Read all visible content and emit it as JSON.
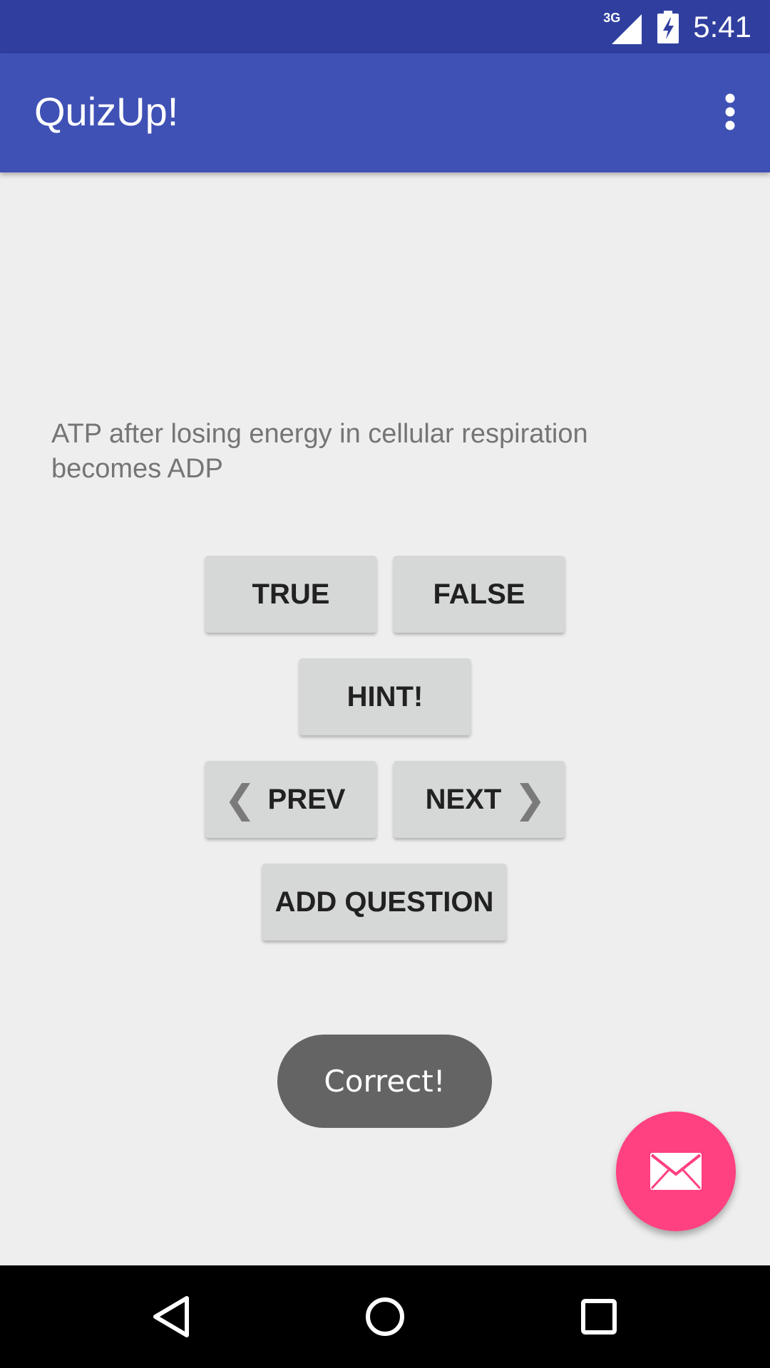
{
  "status_bar": {
    "network_type": "3G",
    "time": "5:41",
    "icons": [
      "signal-icon",
      "battery-charging-icon"
    ]
  },
  "app_bar": {
    "title": "QuizUp!",
    "menu_icon": "more-vert-icon"
  },
  "question": {
    "text": "ATP after losing energy in cellular respiration becomes ADP"
  },
  "buttons": {
    "true_label": "TRUE",
    "false_label": "FALSE",
    "hint_label": "HINT!",
    "prev_label": "PREV",
    "next_label": "NEXT",
    "add_question_label": "ADD QUESTION",
    "prev_icon": "chevron-left-icon",
    "next_icon": "chevron-right-icon"
  },
  "toast": {
    "message": "Correct!"
  },
  "fab": {
    "icon": "email-icon",
    "color": "#ff4081"
  },
  "nav_bar": {
    "icons": [
      "back-icon",
      "home-icon",
      "recents-icon"
    ]
  },
  "colors": {
    "status_bar": "#303f9f",
    "app_bar": "#3f51b5",
    "accent": "#ff4081",
    "background": "#eeeeee"
  }
}
